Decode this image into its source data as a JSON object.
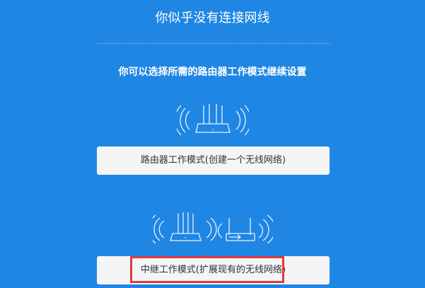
{
  "header": {
    "title": "你似乎没有连接网线"
  },
  "main": {
    "subtitle": "你可以选择所需的路由器工作模式继续设置",
    "modes": [
      {
        "label": "路由器工作模式(创建一个无线网络)",
        "icon": "router-wifi-icon"
      },
      {
        "label": "中继工作模式(扩展现有的无线网络)",
        "icon": "repeater-wifi-icon"
      }
    ]
  },
  "colors": {
    "background": "#1f86e3",
    "button_bg": "#f5f5f5",
    "button_text": "#333333",
    "highlight": "#e03a3a"
  }
}
